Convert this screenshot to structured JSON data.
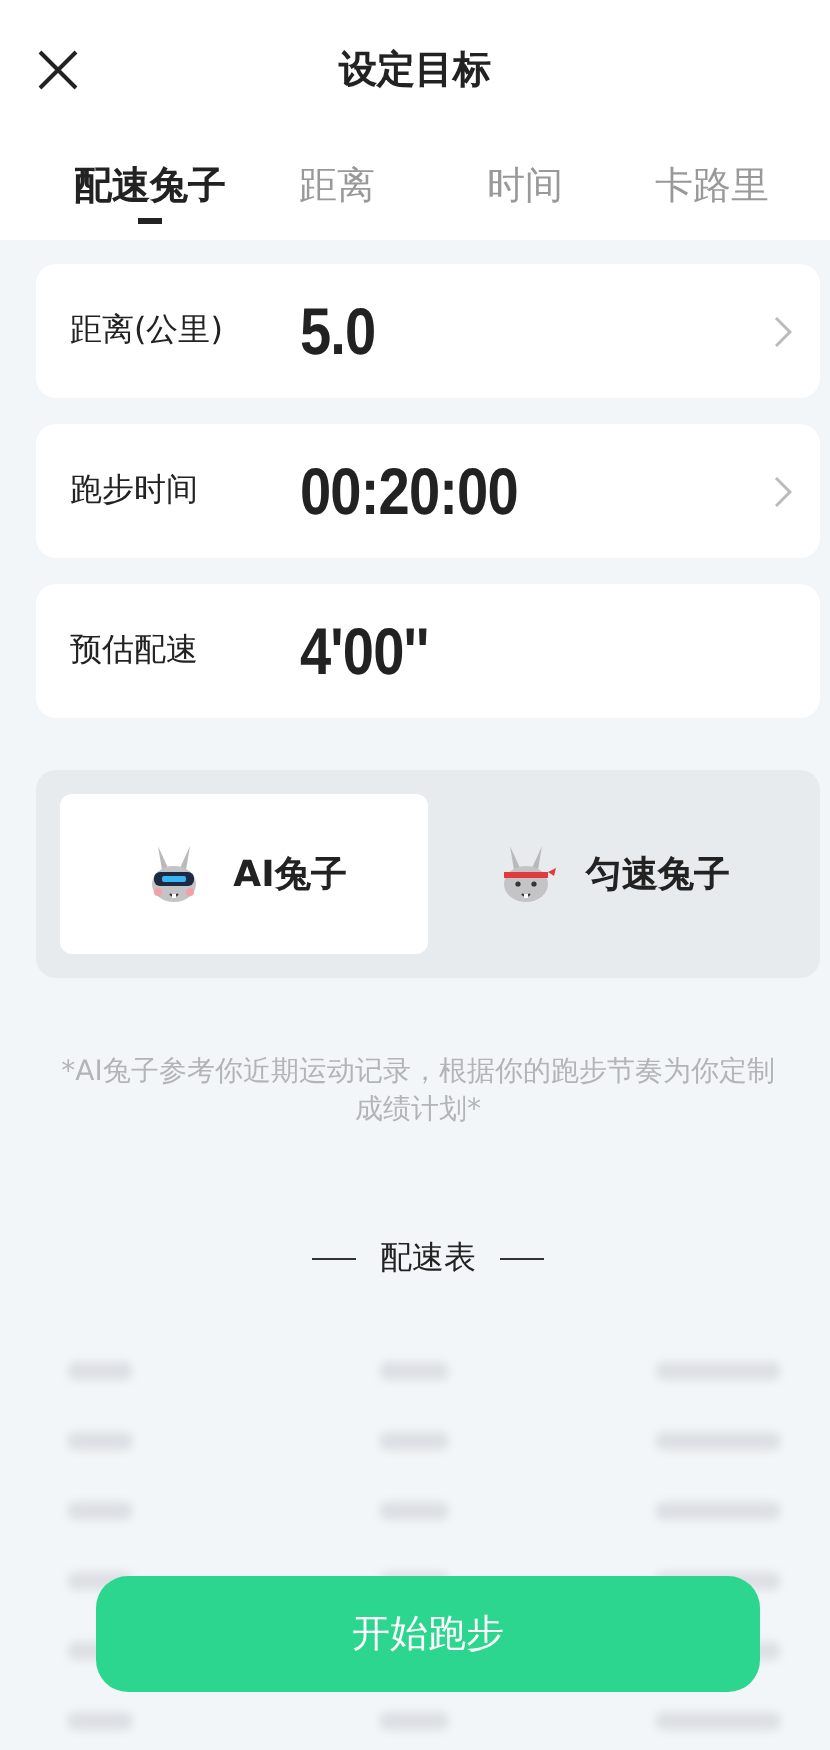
{
  "header": {
    "title": "设定目标"
  },
  "tabs": [
    {
      "label": "配速兔子",
      "selected": true
    },
    {
      "label": "距离",
      "selected": false
    },
    {
      "label": "时间",
      "selected": false
    },
    {
      "label": "卡路里",
      "selected": false
    }
  ],
  "fields": [
    {
      "label": "距离(公里)",
      "value": "5.0",
      "editable": true
    },
    {
      "label": "跑步时间",
      "value": "00:20:00",
      "editable": true
    },
    {
      "label": "预估配速",
      "value": "4'00''",
      "editable": false
    }
  ],
  "rabbit_modes": [
    {
      "label": "AI兔子",
      "kind": "ai",
      "selected": true
    },
    {
      "label": "匀速兔子",
      "kind": "steady",
      "selected": false
    }
  ],
  "note": "*AI兔子参考你近期运动记录，根据你的跑步节奏为你定制成绩计划*",
  "pace_table": {
    "title": "配速表"
  },
  "start_button": "开始跑步"
}
